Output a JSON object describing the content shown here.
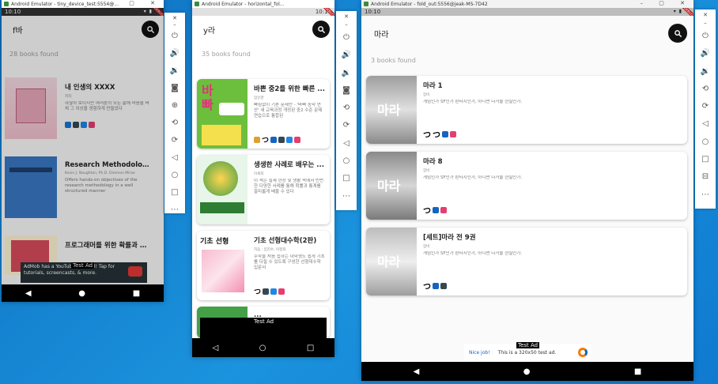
{
  "win1": {
    "title": "Android Emulator - tiny_device_test:5554@...",
    "time": "10:10",
    "query": "f바",
    "count": "28 books found",
    "books": [
      {
        "title": "내 인생의 XXXX",
        "author": "저자",
        "desc": "하찮아 보이지만 여러분의 모든 삶에 마음을 바쳐 그 이상을 경험하게 만들었다"
      },
      {
        "title": "Research Methodology in ...",
        "author": "Kevin J. Naughton, Ph.D. Diemoni Mirae",
        "desc": "Offers hands-on objectives of the research methodology in a well structured manner"
      },
      {
        "title": "프로그래머를 위한 확률과 통계",
        "author": "",
        "desc": ""
      }
    ],
    "admob": "AdMob has a YouTube channel! Tap for tutorials, screencasts, & more.",
    "test_ad": "Test Ad"
  },
  "win2": {
    "title": "Android Emulator - horizontal_fol...",
    "time": "10:10",
    "query": "y라",
    "count": "35 books found",
    "books": [
      {
        "title": "바쁜 중2를 위한 빠른 ...",
        "author": "엄선경",
        "desc": "빠짐없이 기본 문제만 - '바빠 중학 연산' 새 교육과정 개정된 중2 수준 문제 연습으로 통합된"
      },
      {
        "title": "생생한 사례로 배우는 ...",
        "author": "이세희",
        "desc": "이 책은 실제 현장 및 생활 속에서 빈번한 다양한 사례를 통해 확률과 통계를 흥미롭게 배울 수 있다"
      },
      {
        "title": "기초 선형대수학(2판)",
        "author": "지음 : 임진수, 이정희",
        "desc": "수학을 처음 접하는 대학생도 쉽게 기초를 다질 수 있도록 구성한 선형대수학 입문서"
      },
      {
        "title": "..."
      }
    ],
    "test_ad": "Test Ad"
  },
  "win3": {
    "title": "Android Emulator - fold_out:5556@jeak-MS-7D42",
    "time": "10:10",
    "query": "마라",
    "count": "3 books found",
    "books": [
      {
        "title": "마라 1",
        "author": "장비",
        "desc": "게임인가 SF인가 판타지인가, 아니면 다거울 현실인가."
      },
      {
        "title": "마라 8",
        "author": "장비",
        "desc": "게임인가 SF인가 판타지인가, 아니면 다거울 현실인가."
      },
      {
        "title": "[세트]마라 전 9권",
        "author": "장비",
        "desc": "게임인가 SF인가 판타지인가, 아니면 다거울 현실인가."
      }
    ],
    "ad_nice": "Nice job!",
    "ad_text": "This is a 320x50 test ad.",
    "test_ad": "Test Ad"
  },
  "colors": {
    "accent": "#111111",
    "desktop": "#1a8fd8"
  }
}
